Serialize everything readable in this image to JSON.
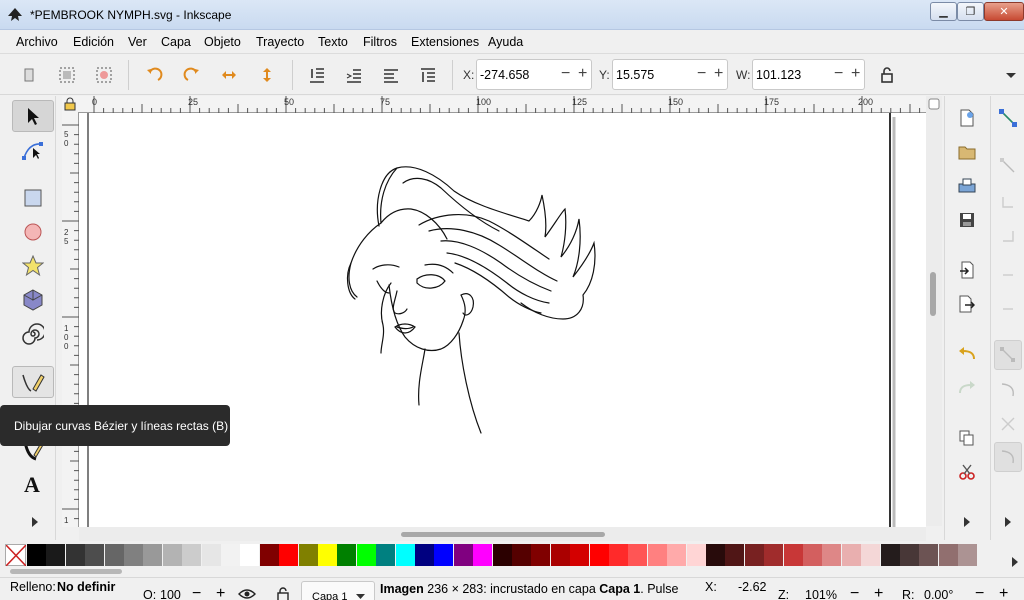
{
  "window": {
    "title": "*PEMBROOK NYMPH.svg - Inkscape"
  },
  "menu": [
    "Archivo",
    "Edición",
    "Ver",
    "Capa",
    "Objeto",
    "Trayecto",
    "Texto",
    "Filtros",
    "Extensiones",
    "Ayuda"
  ],
  "toolbar": {
    "x_label": "X:",
    "x_value": "-274.658",
    "y_label": "Y:",
    "y_value": "15.575",
    "w_label": "W:",
    "w_value": "101.123"
  },
  "ruler": {
    "h_labels": [
      "0",
      "25",
      "50",
      "75",
      "100",
      "125",
      "150",
      "175",
      "200"
    ]
  },
  "tooltip": "Dibujar curvas Bézier y líneas rectas (B)",
  "status": {
    "fill_label": "Relleno:",
    "fill_value": "No definir",
    "opacity_label": "O:",
    "opacity_value": "100",
    "layer_value": "Capa 1",
    "message_bold1": "Imagen",
    "message_mid": " 236 × 283: incrustado en capa ",
    "message_bold2": "Capa 1",
    "message_tail": ". Pulse",
    "x_label": "X:",
    "x_value": "-2.62",
    "z_label": "Z:",
    "zoom_value": "101%",
    "r_label": "R:",
    "rotation_value": "0.00°"
  },
  "palette_colors": [
    "#000000",
    "#1a1a1a",
    "#333333",
    "#4d4d4d",
    "#666666",
    "#808080",
    "#999999",
    "#b3b3b3",
    "#cccccc",
    "#e6e6e6",
    "#f2f2f2",
    "#ffffff",
    "#800000",
    "#ff0000",
    "#808000",
    "#ffff00",
    "#008000",
    "#00ff00",
    "#008080",
    "#00ffff",
    "#000080",
    "#0000ff",
    "#800080",
    "#ff00ff",
    "#2b0000",
    "#550000",
    "#800000",
    "#aa0000",
    "#d40000",
    "#ff0000",
    "#ff2a2a",
    "#ff5555",
    "#ff8080",
    "#ffaaaa",
    "#ffd5d5",
    "#280b0b",
    "#501616",
    "#782121",
    "#a02c2c",
    "#c83737",
    "#d35f5f",
    "#de8787",
    "#e9afaf",
    "#f4d7d7",
    "#241c1c",
    "#483737",
    "#6c5353",
    "#916f6f",
    "#ac9393"
  ]
}
